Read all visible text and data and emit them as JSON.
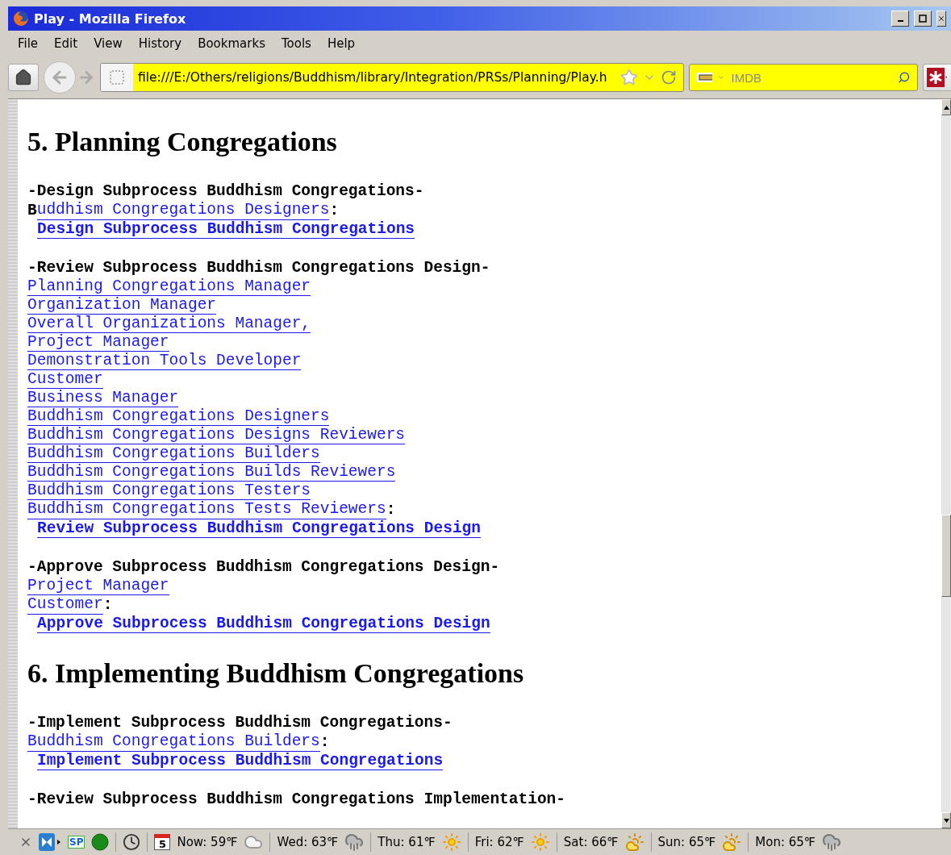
{
  "window": {
    "title": "Play - Mozilla Firefox"
  },
  "menu": [
    {
      "label": "File"
    },
    {
      "label": "Edit"
    },
    {
      "label": "View"
    },
    {
      "label": "History"
    },
    {
      "label": "Bookmarks"
    },
    {
      "label": "Tools"
    },
    {
      "label": "Help"
    }
  ],
  "toolbar": {
    "address": "file:///E:/Others/religions/Buddhism/library/Integration/PRSs/Planning/Play.h",
    "search": {
      "placeholder": "IMDB"
    }
  },
  "sections": [
    {
      "heading": "5. Planning Congregations",
      "blocks": [
        {
          "title": "-Design Subprocess Buddhism Congregations-",
          "roles": [
            {
              "lead": "B",
              "text": "uddhism Congregations Designers",
              "suffix": ":"
            }
          ],
          "action": "Design Subprocess Buddhism Congregations"
        },
        {
          "title": "-Review Subprocess Buddhism Congregations Design-",
          "roles": [
            {
              "text": "Planning Congregations Manager"
            },
            {
              "text": "Organization Manager"
            },
            {
              "text": "Overall Organizations Manager,"
            },
            {
              "text": "Project Manager"
            },
            {
              "text": "Demonstration Tools Developer"
            },
            {
              "text": "Customer"
            },
            {
              "text": "Business Manager"
            },
            {
              "text": "Buddhism Congregations Designers"
            },
            {
              "text": "Buddhism Congregations Designs Reviewers"
            },
            {
              "text": "Buddhism Congregations Builders"
            },
            {
              "text": "Buddhism Congregations Builds Reviewers"
            },
            {
              "text": "Buddhism Congregations Testers"
            },
            {
              "text": "Buddhism Congregations Tests Reviewers",
              "suffix": ":"
            }
          ],
          "action": "Review Subprocess Buddhism Congregations Design"
        },
        {
          "title": "-Approve Subprocess Buddhism Congregations Design-",
          "roles": [
            {
              "text": "Project Manager"
            },
            {
              "text": "Customer",
              "suffix": ":"
            }
          ],
          "action": "Approve Subprocess Buddhism Congregations Design"
        }
      ]
    },
    {
      "heading": "6. Implementing Buddhism Congregations",
      "blocks": [
        {
          "title": "-Implement Subprocess Buddhism Congregations-",
          "roles": [
            {
              "text": "Buddhism Congregations Builders",
              "suffix": ":"
            }
          ],
          "action": "Implement Subprocess Buddhism Congregations"
        },
        {
          "title": "-Review Subprocess Buddhism Congregations Implementation-"
        }
      ]
    }
  ],
  "status_bar": {
    "sp_label": "SP",
    "calendar_day": "5",
    "weather": [
      {
        "label": "Now: 59℉",
        "kind": "cloudy"
      },
      {
        "label": "Wed: 63℉",
        "kind": "rain"
      },
      {
        "label": "Thu: 61℉",
        "kind": "sunny"
      },
      {
        "label": "Fri: 62℉",
        "kind": "sunny"
      },
      {
        "label": "Sat: 66℉",
        "kind": "partly"
      },
      {
        "label": "Sun: 65℉",
        "kind": "partly"
      },
      {
        "label": "Mon: 65℉",
        "kind": "rain"
      }
    ]
  }
}
